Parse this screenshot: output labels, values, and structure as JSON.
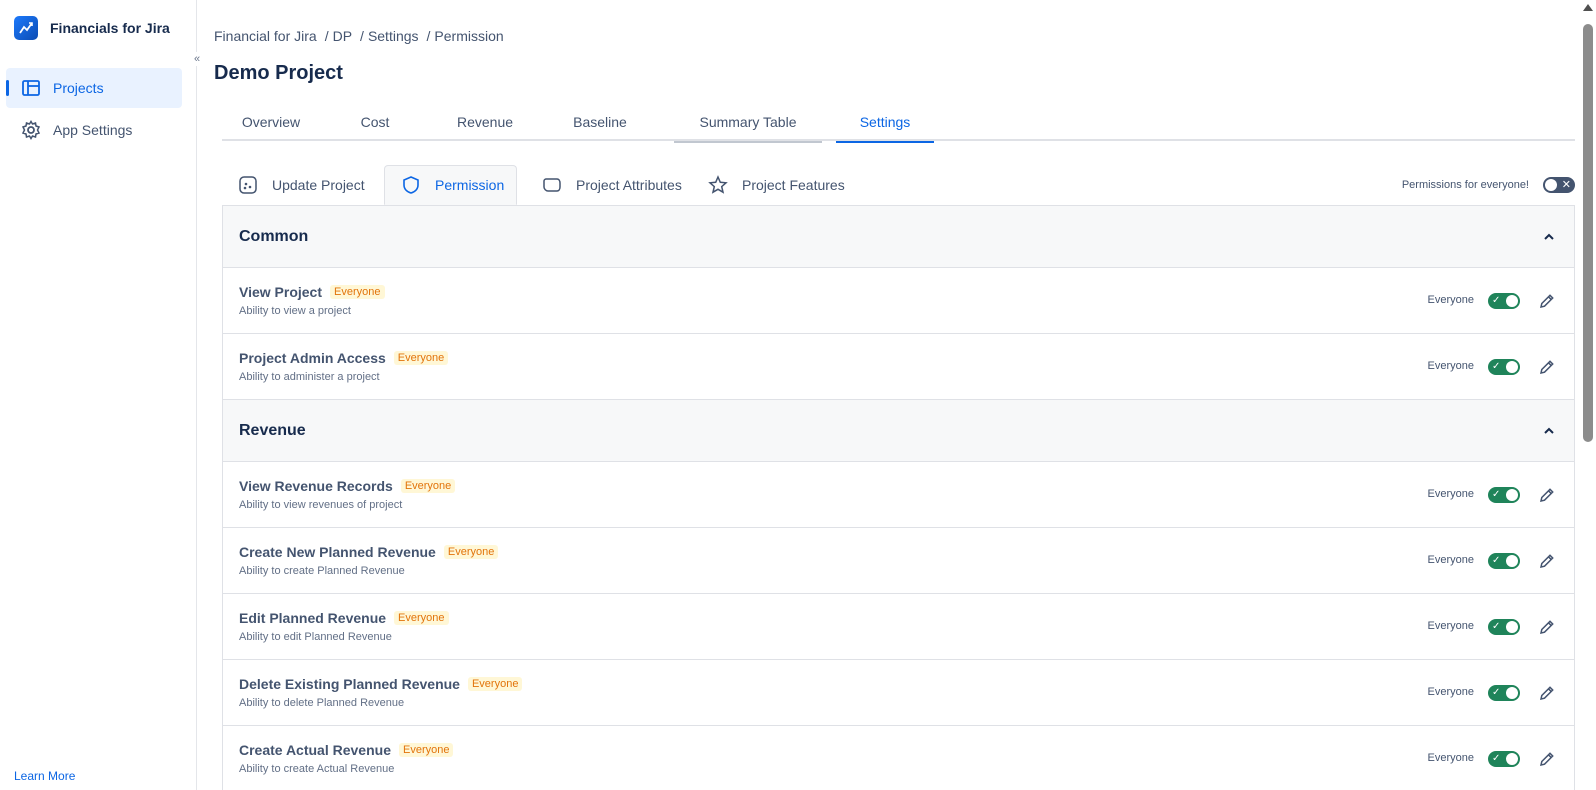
{
  "sidebar": {
    "app_name": "Financials for Jira",
    "collapse_glyph": "«",
    "items": [
      {
        "label": "Projects",
        "icon": "table-icon",
        "active": true
      },
      {
        "label": "App Settings",
        "icon": "gear-icon",
        "active": false
      }
    ],
    "learn_more": "Learn More"
  },
  "breadcrumb": [
    "Financial for Jira",
    "DP",
    "Settings",
    "Permission"
  ],
  "page_title": "Demo Project",
  "tabs": [
    "Overview",
    "Cost",
    "Revenue",
    "Baseline",
    "Summary Table",
    "Settings"
  ],
  "active_tab": "Settings",
  "subtabs": [
    "Update Project",
    "Permission",
    "Project Attributes",
    "Project Features"
  ],
  "active_subtab": "Permission",
  "permissions_for_everyone": {
    "label": "Permissions for everyone!",
    "enabled": false
  },
  "sections": [
    {
      "title": "Common",
      "rows": [
        {
          "name": "View Project",
          "badge": "Everyone",
          "desc": "Ability to view a project",
          "who": "Everyone",
          "enabled": true
        },
        {
          "name": "Project Admin Access",
          "badge": "Everyone",
          "desc": "Ability to administer a project",
          "who": "Everyone",
          "enabled": true
        }
      ]
    },
    {
      "title": "Revenue",
      "rows": [
        {
          "name": "View Revenue Records",
          "badge": "Everyone",
          "desc": "Ability to view revenues of project",
          "who": "Everyone",
          "enabled": true
        },
        {
          "name": "Create New Planned Revenue",
          "badge": "Everyone",
          "desc": "Ability to create Planned Revenue",
          "who": "Everyone",
          "enabled": true
        },
        {
          "name": "Edit Planned Revenue",
          "badge": "Everyone",
          "desc": "Ability to edit Planned Revenue",
          "who": "Everyone",
          "enabled": true
        },
        {
          "name": "Delete Existing Planned Revenue",
          "badge": "Everyone",
          "desc": "Ability to delete Planned Revenue",
          "who": "Everyone",
          "enabled": true
        },
        {
          "name": "Create Actual Revenue",
          "badge": "Everyone",
          "desc": "Ability to create Actual Revenue",
          "who": "Everyone",
          "enabled": true
        }
      ]
    }
  ],
  "colors": {
    "accent": "#0c66e4",
    "toggle_on": "#1f845a",
    "badge_text": "#e2740b"
  }
}
